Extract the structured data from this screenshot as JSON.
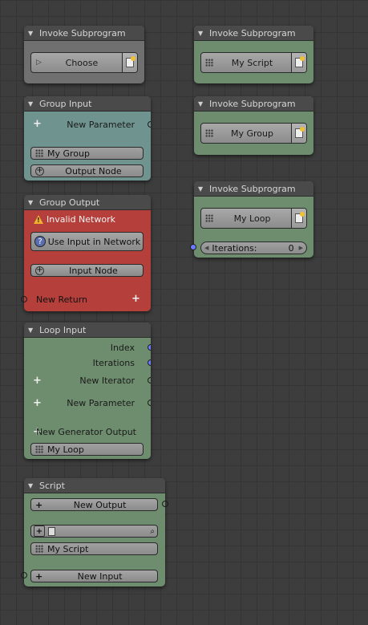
{
  "colors": {
    "background": "#3d3d3d",
    "node_header": "#4a4a4a",
    "teal_node": "#6f938f",
    "green_node": "#6e8d6e",
    "red_node": "#b53f3a",
    "gray_node": "#707070",
    "socket_blue": "#6b7bff"
  },
  "invoke1": {
    "title": "Invoke Subprogram",
    "choose_label": "Choose"
  },
  "invoke2": {
    "title": "Invoke Subprogram",
    "picker_label": "My Script"
  },
  "invoke3": {
    "title": "Invoke Subprogram",
    "picker_label": "My Group"
  },
  "invoke4": {
    "title": "Invoke Subprogram",
    "picker_label": "My Loop",
    "iterations_label": "Iterations:",
    "iterations_value": "0"
  },
  "group_input": {
    "title": "Group Input",
    "new_parameter": "New Parameter",
    "group_name": "My Group",
    "output_node": "Output Node"
  },
  "group_output": {
    "title": "Group Output",
    "warning": "Invalid Network",
    "use_input": "Use Input in Network",
    "input_node": "Input Node",
    "new_return": "New Return"
  },
  "loop_input": {
    "title": "Loop Input",
    "index": "Index",
    "iterations": "Iterations",
    "new_iterator": "New Iterator",
    "new_parameter": "New Parameter",
    "new_generator_output": "New Generator Output",
    "loop_name": "My Loop"
  },
  "script": {
    "title": "Script",
    "new_output": "New Output",
    "script_name": "My Script",
    "new_input": "New Input"
  }
}
